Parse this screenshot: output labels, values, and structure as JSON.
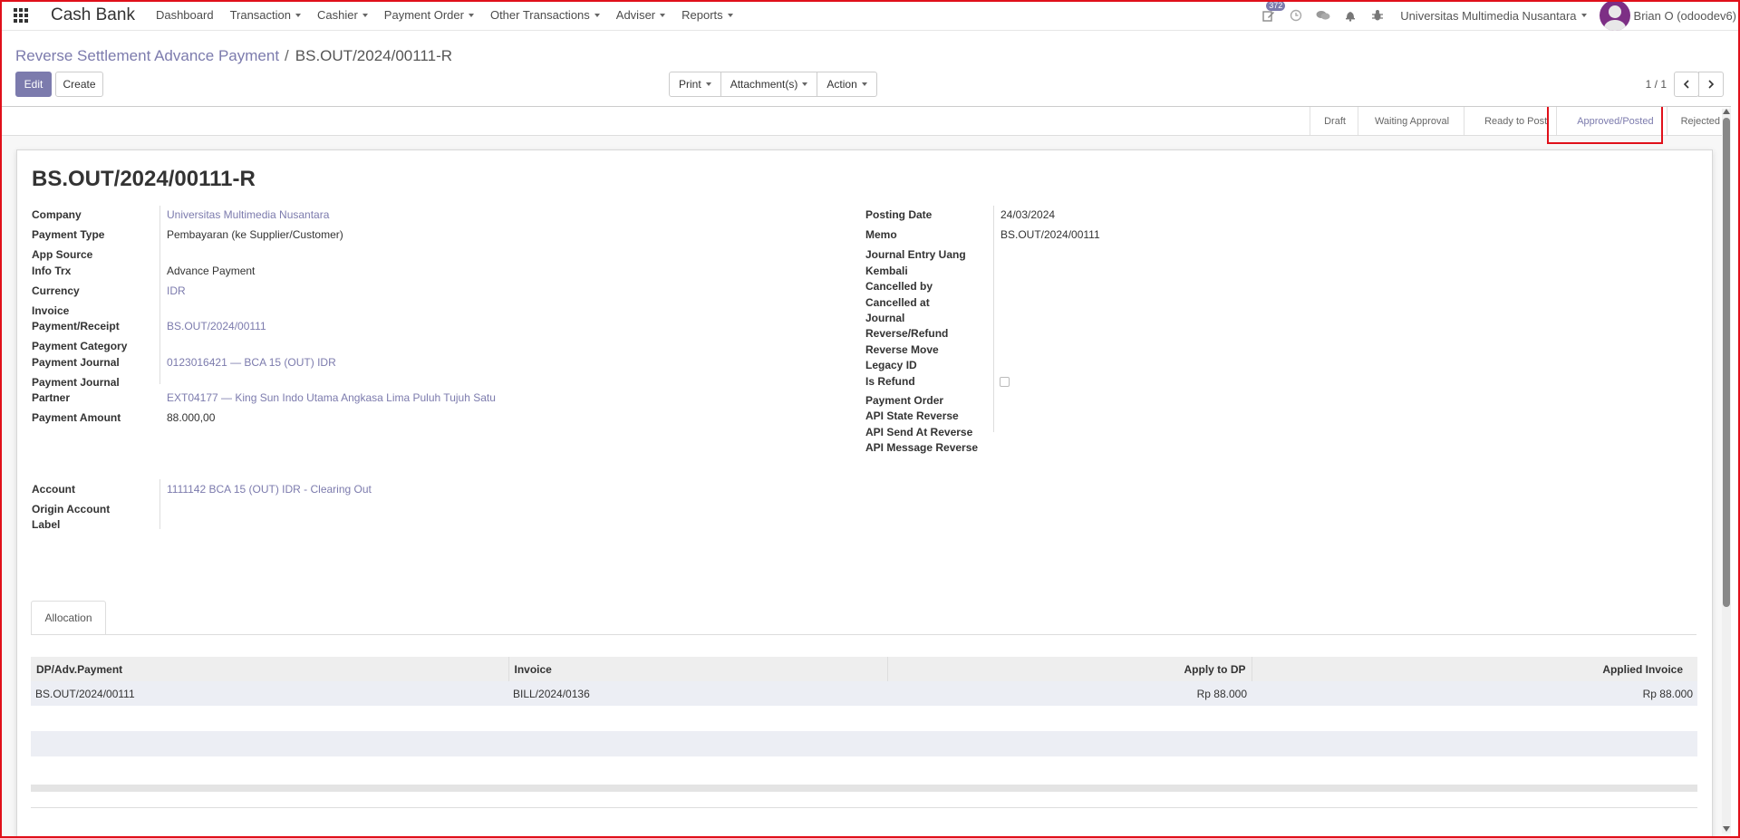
{
  "navbar": {
    "brand": "Cash Bank",
    "menu": [
      "Dashboard",
      "Transaction",
      "Cashier",
      "Payment Order",
      "Other Transactions",
      "Adviser",
      "Reports"
    ],
    "notification_count": "372",
    "company": "Universitas Multimedia Nusantara",
    "user": "Brian O (odoodev6)"
  },
  "breadcrumb": {
    "parent": "Reverse Settlement Advance Payment",
    "separator": "/",
    "current": "BS.OUT/2024/00111-R"
  },
  "buttons": {
    "edit": "Edit",
    "create": "Create",
    "print": "Print",
    "attachments": "Attachment(s)",
    "action": "Action"
  },
  "pager": {
    "value": "1 / 1"
  },
  "stages": [
    "Draft",
    "Waiting Approval",
    "Ready to Post",
    "Approved/Posted",
    "Rejected"
  ],
  "current_stage": "Approved/Posted",
  "form": {
    "title": "BS.OUT/2024/00111-R",
    "left_fields": {
      "company_label": "Company",
      "company": "Universitas Multimedia Nusantara",
      "payment_type_label": "Payment Type",
      "payment_type": "Pembayaran (ke Supplier/Customer)",
      "app_source_label": "App Source",
      "info_trx_label": "Info Trx",
      "info_trx": "Advance Payment",
      "currency_label": "Currency",
      "currency": "IDR",
      "invoice_label_1": "Invoice",
      "invoice_label_2": "Payment/Receipt",
      "invoice": "BS.OUT/2024/00111",
      "payment_category_label": "Payment Category",
      "payment_journal_label": "Payment Journal",
      "payment_journal": "0123016421 — BCA 15 (OUT) IDR",
      "pj_partner_label_1": "Payment Journal",
      "pj_partner_label_2": "Partner",
      "pj_partner": "EXT04177 — King Sun Indo Utama Angkasa Lima Puluh Tujuh Satu",
      "payment_amount_label": "Payment Amount",
      "payment_amount": "88.000,00"
    },
    "right_fields": {
      "posting_date_label": "Posting Date",
      "posting_date": "24/03/2024",
      "memo_label": "Memo",
      "memo": "BS.OUT/2024/00111",
      "je_uang_kembali_label_1": "Journal Entry Uang",
      "je_uang_kembali_label_2": "Kembali",
      "cancelled_by_label": "Cancelled by",
      "cancelled_at_label": "Cancelled at",
      "journal_reverse_label_1": "Journal",
      "journal_reverse_label_2": "Reverse/Refund",
      "reverse_move_label": "Reverse Move",
      "legacy_id_label": "Legacy ID",
      "is_refund_label": "Is Refund",
      "payment_order_label": "Payment Order",
      "api_state_label": "API State Reverse",
      "api_send_label": "API Send At Reverse",
      "api_message_label": "API Message Reverse"
    },
    "account_fields": {
      "account_label": "Account",
      "account": "1111142 BCA 15 (OUT) IDR - Clearing Out",
      "origin_label_1": "Origin Account",
      "origin_label_2": "Label"
    }
  },
  "tabs": {
    "allocation": "Allocation"
  },
  "allocation_table": {
    "headers": [
      "DP/Adv.Payment",
      "Invoice",
      "Apply to DP",
      "Applied Invoice"
    ],
    "rows": [
      [
        "BS.OUT/2024/00111",
        "BILL/2024/0136",
        "Rp 88.000",
        "Rp 88.000"
      ]
    ]
  }
}
